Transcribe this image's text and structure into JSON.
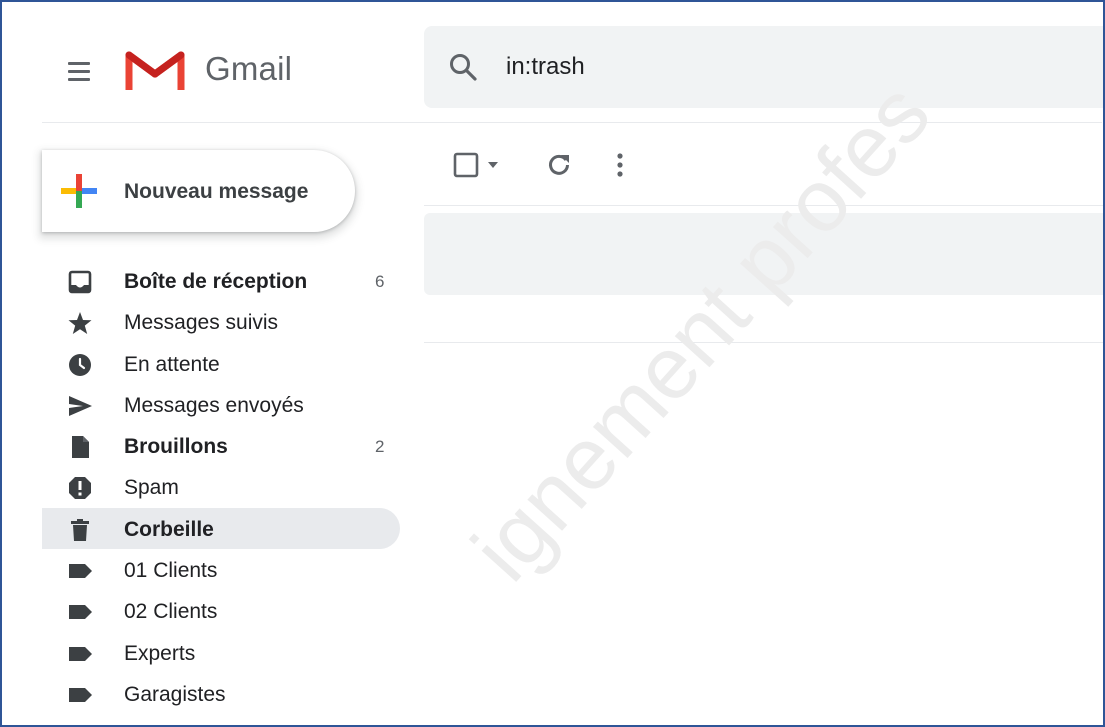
{
  "header": {
    "brand": "Gmail",
    "menu_icon": "hamburger-menu-icon",
    "logo_icon": "gmail-m-logo-icon"
  },
  "search": {
    "value": "in:trash",
    "icon": "search-icon"
  },
  "compose": {
    "label": "Nouveau message",
    "icon": "plus-icon"
  },
  "sidebar": {
    "items": [
      {
        "label": "Boîte de réception",
        "count": "6",
        "icon": "inbox-icon",
        "bold": true
      },
      {
        "label": "Messages suivis",
        "count": "",
        "icon": "star-icon"
      },
      {
        "label": "En attente",
        "count": "",
        "icon": "clock-icon"
      },
      {
        "label": "Messages envoyés",
        "count": "",
        "icon": "send-icon"
      },
      {
        "label": "Brouillons",
        "count": "2",
        "icon": "draft-icon",
        "bold": true
      },
      {
        "label": "Spam",
        "count": "",
        "icon": "spam-icon"
      },
      {
        "label": "Corbeille",
        "count": "",
        "icon": "trash-icon",
        "bold": true,
        "active": true
      },
      {
        "label": "01 Clients",
        "count": "",
        "icon": "label-icon"
      },
      {
        "label": "02 Clients",
        "count": "",
        "icon": "label-icon"
      },
      {
        "label": "Experts",
        "count": "",
        "icon": "label-icon"
      },
      {
        "label": "Garagistes",
        "count": "",
        "icon": "label-icon"
      }
    ]
  },
  "toolbar": {
    "icons": [
      "checkbox-icon",
      "chevron-down-icon",
      "refresh-icon",
      "more-vert-icon"
    ]
  },
  "watermark": "ignement profes",
  "colors": {
    "frame_border": "#2f5597",
    "active_bg": "#e8eaed",
    "search_bg": "#f1f3f4",
    "gmail_red": "#ea4335",
    "google_blue": "#4285f4",
    "google_green": "#34a853",
    "google_yellow": "#fbbc04"
  }
}
